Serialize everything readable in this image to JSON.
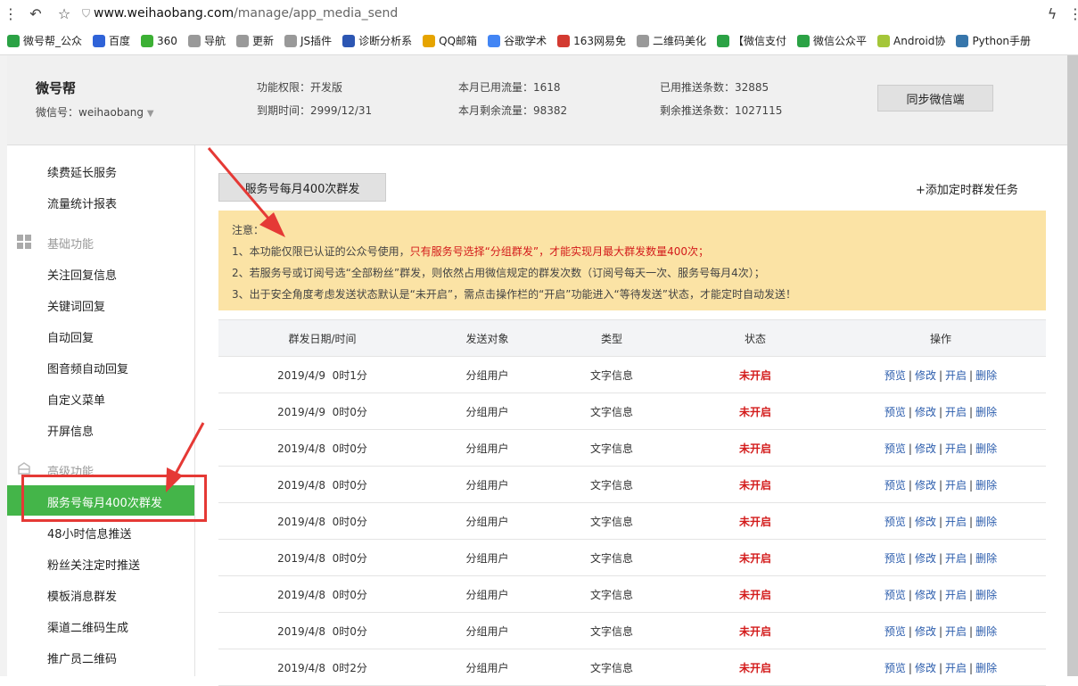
{
  "browser": {
    "url_host": "www.weihaobang.com",
    "url_path": "/manage/app_media_send",
    "bookmarks": [
      {
        "label": "微号帮_公众",
        "color": "#2ba245"
      },
      {
        "label": "百度",
        "color": "#2f63d8"
      },
      {
        "label": "360",
        "color": "#3cb034"
      },
      {
        "label": "导航",
        "color": "#999999"
      },
      {
        "label": "更新",
        "color": "#999999"
      },
      {
        "label": "JS插件",
        "color": "#999999"
      },
      {
        "label": "诊断分析系",
        "color": "#2c56b3"
      },
      {
        "label": "QQ邮箱",
        "color": "#e6a400"
      },
      {
        "label": "谷歌学术",
        "color": "#4285f4"
      },
      {
        "label": "163网易免",
        "color": "#d33a31"
      },
      {
        "label": "二维码美化",
        "color": "#999999"
      },
      {
        "label": "【微信支付",
        "color": "#2ba245"
      },
      {
        "label": "微信公众平",
        "color": "#2ba245"
      },
      {
        "label": "Android协",
        "color": "#a4c639"
      },
      {
        "label": "Python手册",
        "color": "#3776ab"
      }
    ]
  },
  "header": {
    "brand": "微号帮",
    "wechat_id": "微信号：weihaobang",
    "perm": "功能权限：开发版",
    "expire": "到期时间：2999/12/31",
    "used_flow": "本月已用流量：1618",
    "left_flow": "本月剩余流量：98382",
    "used_push": "已用推送条数：32885",
    "left_push": "剩余推送条数：1027115",
    "sync_label": "同步微信端"
  },
  "sidebar": {
    "top_items": [
      "续费延长服务",
      "流量统计报表"
    ],
    "group_basic": "基础功能",
    "basic_items": [
      "关注回复信息",
      "关键词回复",
      "自动回复",
      "图音频自动回复",
      "自定义菜单",
      "开屏信息"
    ],
    "group_adv": "高级功能",
    "active_item": "服务号每月400次群发",
    "adv_items": [
      "48小时信息推送",
      "粉丝关注定时推送",
      "模板消息群发",
      "渠道二维码生成",
      "推广员二维码"
    ]
  },
  "main": {
    "tab_label": "服务号每月400次群发",
    "add_task": "+添加定时群发任务",
    "notice": {
      "title": "注意：",
      "line1_a": "1、本功能仅限已认证的公众号使用，",
      "line1_b": "只有服务号选择“分组群发”，才能实现月最大群发数量400次；",
      "line2": "2、若服务号或订阅号选“全部粉丝”群发，则依然占用微信规定的群发次数（订阅号每天一次、服务号每月4次）；",
      "line3": "3、出于安全角度考虑发送状态默认是“未开启”，需点击操作栏的“开启”功能进入“等待发送”状态，才能定时自动发送！"
    },
    "table": {
      "headers": [
        "群发日期/时间",
        "发送对象",
        "类型",
        "状态",
        "操作"
      ],
      "ops": [
        "预览",
        "修改",
        "开启",
        "删除"
      ],
      "rows": [
        {
          "date": "2019/4/9  0时1分",
          "target": "分组用户",
          "type": "文字信息",
          "status": "未开启"
        },
        {
          "date": "2019/4/9  0时0分",
          "target": "分组用户",
          "type": "文字信息",
          "status": "未开启"
        },
        {
          "date": "2019/4/8  0时0分",
          "target": "分组用户",
          "type": "文字信息",
          "status": "未开启"
        },
        {
          "date": "2019/4/8  0时0分",
          "target": "分组用户",
          "type": "文字信息",
          "status": "未开启"
        },
        {
          "date": "2019/4/8  0时0分",
          "target": "分组用户",
          "type": "文字信息",
          "status": "未开启"
        },
        {
          "date": "2019/4/8  0时0分",
          "target": "分组用户",
          "type": "文字信息",
          "status": "未开启"
        },
        {
          "date": "2019/4/8  0时0分",
          "target": "分组用户",
          "type": "文字信息",
          "status": "未开启"
        },
        {
          "date": "2019/4/8  0时0分",
          "target": "分组用户",
          "type": "文字信息",
          "status": "未开启"
        },
        {
          "date": "2019/4/8  0时2分",
          "target": "分组用户",
          "type": "文字信息",
          "status": "未开启"
        }
      ]
    }
  },
  "colors": {
    "accent": "#44b549",
    "notice_bg": "#fbe3a5",
    "status_red": "#d31b1b",
    "link": "#2b5cac",
    "annotation_red": "#e53935"
  }
}
